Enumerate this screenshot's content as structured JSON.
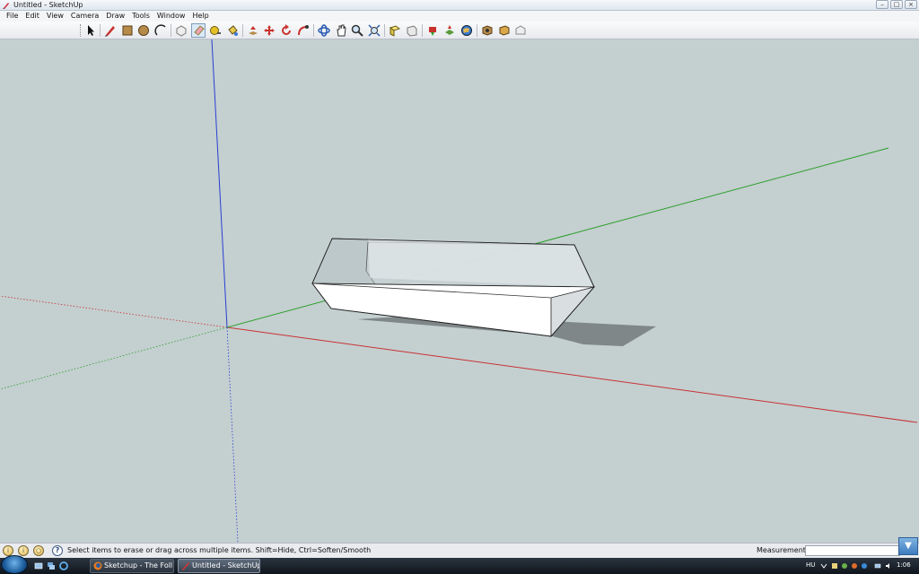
{
  "window": {
    "title": "Untitled - SketchUp"
  },
  "menu": [
    "File",
    "Edit",
    "View",
    "Camera",
    "Draw",
    "Tools",
    "Window",
    "Help"
  ],
  "toolbar_tools": [
    "select-icon",
    "pencil-icon",
    "rectangle-icon",
    "circle-icon",
    "arc-icon",
    "make-component-icon",
    "eraser-icon",
    "tape-measure-icon",
    "paint-bucket-icon",
    "push-pull-icon",
    "move-icon",
    "rotate-icon",
    "follow-me-icon",
    "orbit-icon",
    "pan-icon",
    "zoom-icon",
    "zoom-extents-icon",
    "components-icon",
    "iso-view-icon",
    "get-models-icon",
    "share-model-icon",
    "google-earth-icon",
    "photo-textures-icon",
    "component-browser-icon",
    "warehouse-icon"
  ],
  "status": {
    "hint": "Select items to erase or drag across multiple items. Shift=Hide, Ctrl=Soften/Smooth",
    "measurements_label": "Measurements",
    "measurements_value": ""
  },
  "taskbar": {
    "items": [
      {
        "label": "Sketchup - The Foll...",
        "active": false
      },
      {
        "label": "Untitled - SketchUp",
        "active": true
      }
    ],
    "language": "HU",
    "clock": "1:06"
  },
  "colors": {
    "viewport_bg": "#c4cfd0",
    "axis_red": "#c83232",
    "axis_green": "#2aa02a",
    "axis_blue": "#2a3fd0"
  }
}
